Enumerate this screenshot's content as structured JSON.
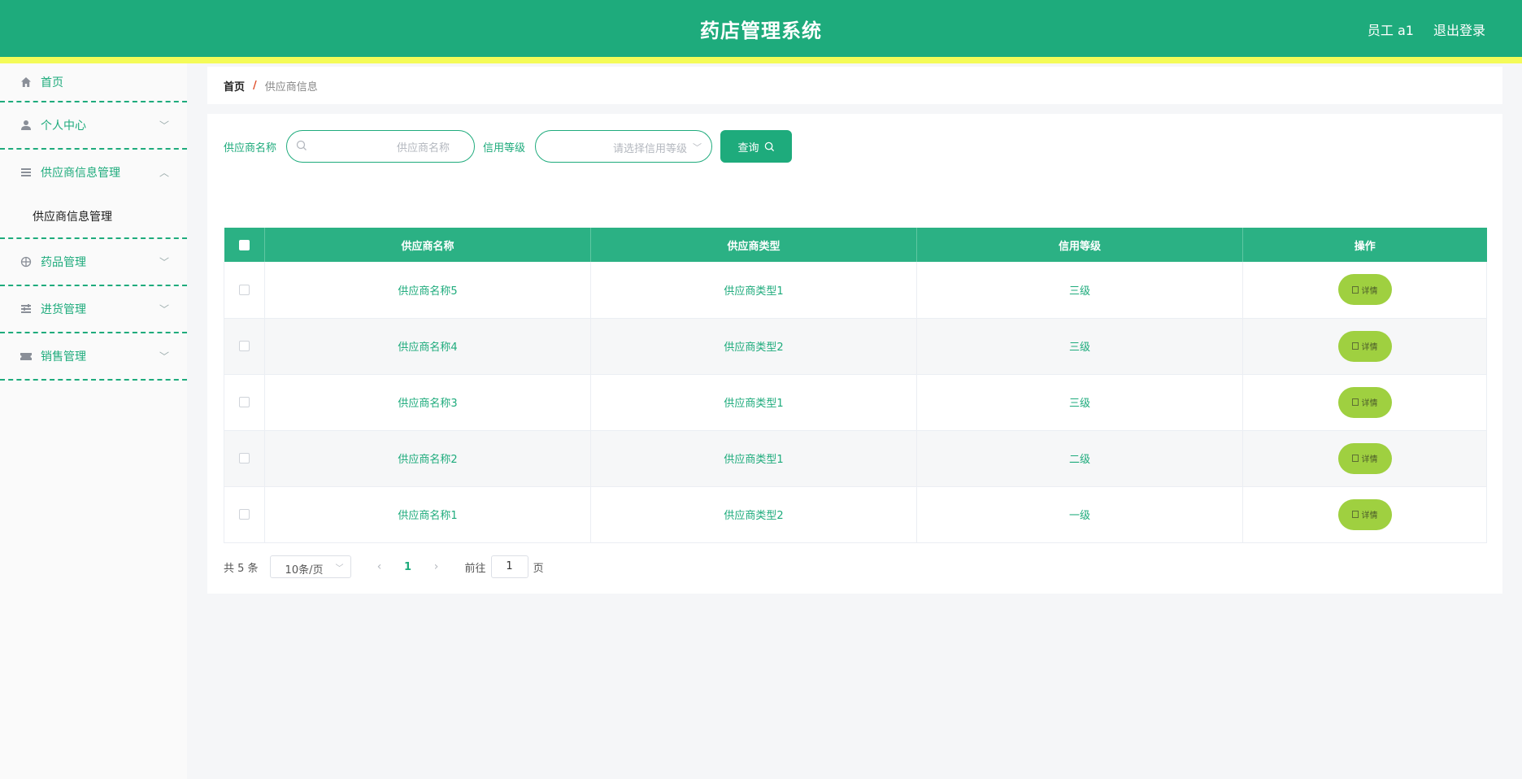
{
  "header": {
    "title": "药店管理系统",
    "user": "员工 a1",
    "logout": "退出登录"
  },
  "sidebar": {
    "items": [
      {
        "label": "首页",
        "icon": "home-icon"
      },
      {
        "label": "个人中心",
        "icon": "user-icon"
      },
      {
        "label": "供应商信息管理",
        "icon": "list-icon",
        "expanded": true,
        "children": [
          "供应商信息管理"
        ]
      },
      {
        "label": "药品管理",
        "icon": "target-icon"
      },
      {
        "label": "进货管理",
        "icon": "sliders-icon"
      },
      {
        "label": "销售管理",
        "icon": "ticket-icon"
      }
    ]
  },
  "breadcrumb": {
    "home": "首页",
    "separator": "/",
    "current": "供应商信息"
  },
  "search": {
    "name_label": "供应商名称",
    "name_placeholder": "供应商名称",
    "level_label": "信用等级",
    "level_placeholder": "请选择信用等级",
    "query_label": "查询"
  },
  "table": {
    "columns": [
      "供应商名称",
      "供应商类型",
      "信用等级",
      "操作"
    ],
    "rows": [
      {
        "name": "供应商名称5",
        "type": "供应商类型1",
        "level": "三级"
      },
      {
        "name": "供应商名称4",
        "type": "供应商类型2",
        "level": "三级"
      },
      {
        "name": "供应商名称3",
        "type": "供应商类型1",
        "level": "三级"
      },
      {
        "name": "供应商名称2",
        "type": "供应商类型1",
        "level": "二级"
      },
      {
        "name": "供应商名称1",
        "type": "供应商类型2",
        "level": "一级"
      }
    ],
    "detail_label": "详情"
  },
  "pagination": {
    "total": "共 5 条",
    "page_size": "10条/页",
    "current_page": "1",
    "goto_label": "前往",
    "goto_value": "1",
    "page_suffix": "页"
  },
  "colors": {
    "primary": "#1eab7c",
    "stripe": "#f4fb58",
    "detail_button": "#9fd040"
  }
}
